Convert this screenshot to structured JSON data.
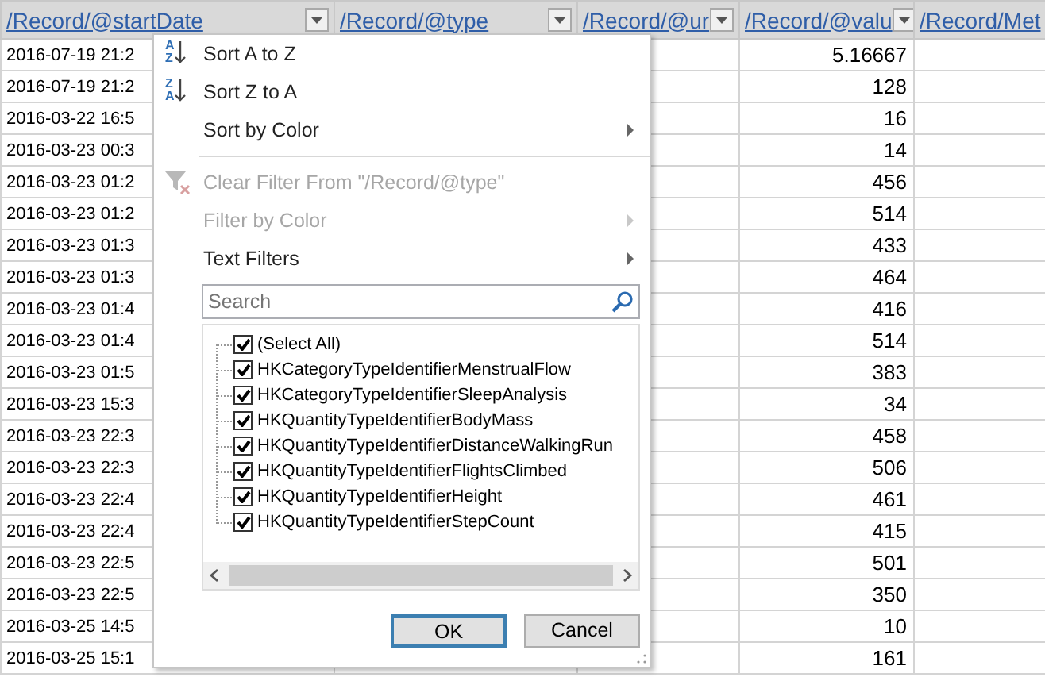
{
  "sheet": {
    "columns": [
      {
        "header": "/Record/@startDate",
        "has_filter": true
      },
      {
        "header": "/Record/@type",
        "has_filter": true
      },
      {
        "header": "/Record/@ur",
        "has_filter": true
      },
      {
        "header": "/Record/@valu",
        "has_filter": true
      },
      {
        "header": "/Record/Met",
        "has_filter": false
      }
    ],
    "rows": [
      {
        "start_date": "2016-07-19 21:2",
        "value": "5.16667"
      },
      {
        "start_date": "2016-07-19 21:2",
        "value": "128"
      },
      {
        "start_date": "2016-03-22 16:5",
        "value": "16"
      },
      {
        "start_date": "2016-03-23 00:3",
        "value": "14"
      },
      {
        "start_date": "2016-03-23 01:2",
        "value": "456"
      },
      {
        "start_date": "2016-03-23 01:2",
        "value": "514"
      },
      {
        "start_date": "2016-03-23 01:3",
        "value": "433"
      },
      {
        "start_date": "2016-03-23 01:3",
        "value": "464"
      },
      {
        "start_date": "2016-03-23 01:4",
        "value": "416"
      },
      {
        "start_date": "2016-03-23 01:4",
        "value": "514"
      },
      {
        "start_date": "2016-03-23 01:5",
        "value": "383"
      },
      {
        "start_date": "2016-03-23 15:3",
        "value": "34"
      },
      {
        "start_date": "2016-03-23 22:3",
        "value": "458"
      },
      {
        "start_date": "2016-03-23 22:3",
        "value": "506"
      },
      {
        "start_date": "2016-03-23 22:4",
        "value": "461"
      },
      {
        "start_date": "2016-03-23 22:4",
        "value": "415"
      },
      {
        "start_date": "2016-03-23 22:5",
        "value": "501"
      },
      {
        "start_date": "2016-03-23 22:5",
        "value": "350"
      },
      {
        "start_date": "2016-03-25 14:5",
        "value": "10"
      },
      {
        "start_date": "2016-03-25 15:1",
        "value": "161"
      }
    ]
  },
  "filter_menu": {
    "items": [
      {
        "kind": "sort-asc",
        "label": "Sort A to Z",
        "icon_top": "A",
        "icon_bottom": "Z",
        "disabled": false,
        "submenu": false
      },
      {
        "kind": "sort-desc",
        "label": "Sort Z to A",
        "icon_top": "Z",
        "icon_bottom": "A",
        "disabled": false,
        "submenu": false
      },
      {
        "kind": "plain",
        "label": "Sort by Color",
        "disabled": false,
        "submenu": true
      },
      {
        "kind": "separator"
      },
      {
        "kind": "clear-filter",
        "label": "Clear Filter From \"/Record/@type\"",
        "disabled": true,
        "submenu": false
      },
      {
        "kind": "plain",
        "label": "Filter by Color",
        "disabled": true,
        "submenu": true
      },
      {
        "kind": "plain",
        "label": "Text Filters",
        "disabled": false,
        "submenu": true
      }
    ],
    "search": {
      "placeholder": "Search"
    },
    "values": [
      {
        "label": "(Select All)",
        "checked": true
      },
      {
        "label": "HKCategoryTypeIdentifierMenstrualFlow",
        "checked": true
      },
      {
        "label": "HKCategoryTypeIdentifierSleepAnalysis",
        "checked": true
      },
      {
        "label": "HKQuantityTypeIdentifierBodyMass",
        "checked": true
      },
      {
        "label": "HKQuantityTypeIdentifierDistanceWalkingRun",
        "checked": true
      },
      {
        "label": "HKQuantityTypeIdentifierFlightsClimbed",
        "checked": true
      },
      {
        "label": "HKQuantityTypeIdentifierHeight",
        "checked": true
      },
      {
        "label": "HKQuantityTypeIdentifierStepCount",
        "checked": true
      }
    ],
    "buttons": [
      {
        "label": "OK",
        "default": true
      },
      {
        "label": "Cancel",
        "default": false
      }
    ]
  }
}
